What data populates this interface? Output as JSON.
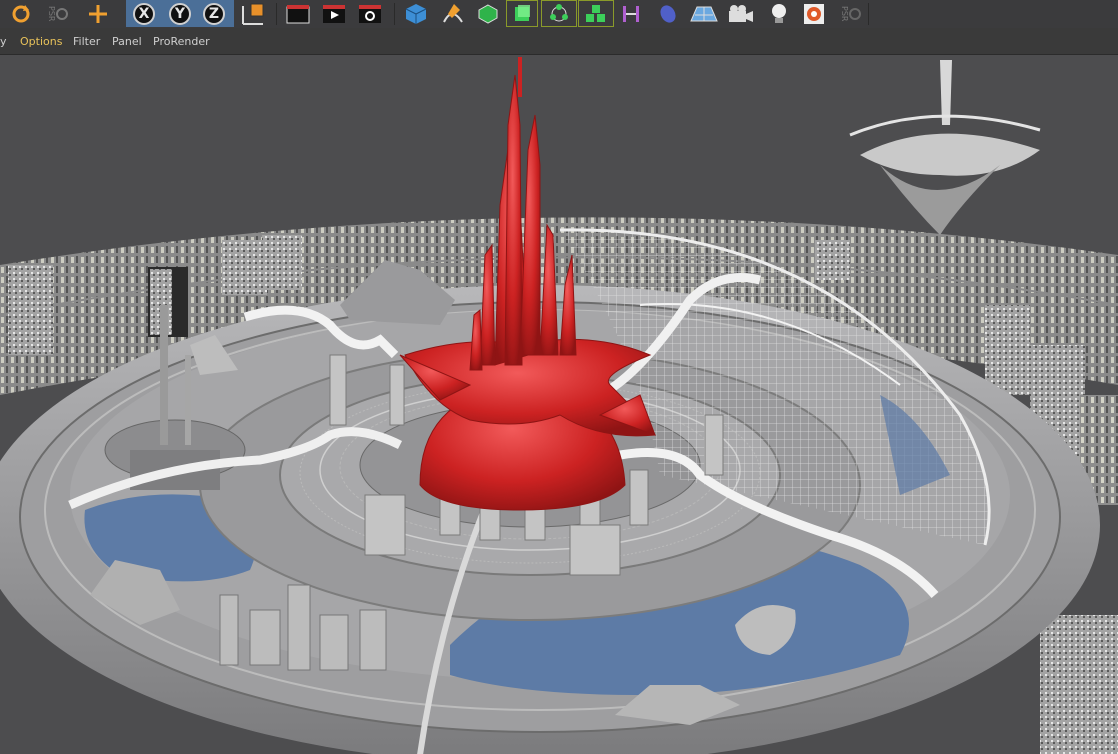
{
  "toolbar": {
    "items": [
      {
        "name": "undo-reload-icon",
        "color": "#f0a030"
      },
      {
        "name": "lock-psr-icon",
        "label": "PSR"
      },
      {
        "name": "move-tool-icon",
        "color": "#f0a030"
      },
      {
        "name": "x-axis-button",
        "label": "X"
      },
      {
        "name": "y-axis-button",
        "label": "Y"
      },
      {
        "name": "z-axis-button",
        "label": "Z"
      },
      {
        "name": "coordinate-system-icon"
      },
      {
        "name": "render-view-icon"
      },
      {
        "name": "render-to-picture-viewer-icon"
      },
      {
        "name": "render-settings-icon"
      },
      {
        "name": "cube-primitive-icon"
      },
      {
        "name": "pen-spline-icon"
      },
      {
        "name": "subdivision-surface-icon"
      },
      {
        "name": "extrude-generator-icon"
      },
      {
        "name": "cloner-icon"
      },
      {
        "name": "array-icon"
      },
      {
        "name": "deformer-icon"
      },
      {
        "name": "field-icon"
      },
      {
        "name": "floor-environment-icon"
      },
      {
        "name": "camera-icon"
      },
      {
        "name": "light-icon"
      },
      {
        "name": "prorender-icon"
      },
      {
        "name": "lock-psr-icon-2",
        "label": "PSR"
      }
    ],
    "axis_active_color": "#4b6f98"
  },
  "menu": {
    "items": [
      {
        "label": "y"
      },
      {
        "label": "Options"
      },
      {
        "label": "Filter"
      },
      {
        "label": "Panel"
      },
      {
        "label": "ProRender"
      }
    ],
    "active_label": "Options",
    "active_color": "#e8c25a"
  },
  "viewport": {
    "highlight_color": "#cc2222",
    "water_color": "#5d7ba6",
    "model_color": "#a8a8aa"
  }
}
